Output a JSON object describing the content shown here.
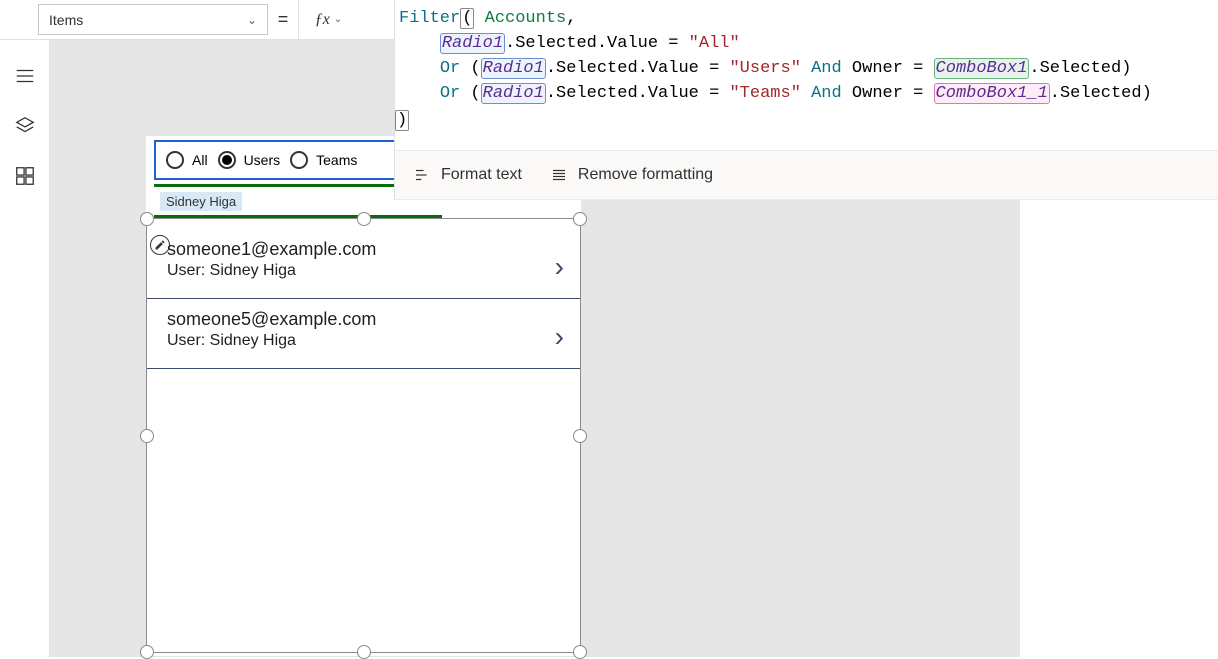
{
  "property_selector": {
    "value": "Items"
  },
  "formula": {
    "tokens": [
      [
        {
          "t": "Filter",
          "c": "t-fn"
        },
        {
          "t": "(",
          "c": "paren-box t-plain"
        },
        {
          "t": " ",
          "c": "t-plain"
        },
        {
          "t": "Accounts",
          "c": "t-ds"
        },
        {
          "t": ",",
          "c": "t-plain"
        }
      ],
      [
        {
          "t": "    ",
          "c": "t-plain"
        },
        {
          "t": "Radio1",
          "c": "t-ref hl-blue"
        },
        {
          "t": ".Selected.Value = ",
          "c": "t-plain"
        },
        {
          "t": "\"All\"",
          "c": "t-str"
        }
      ],
      [
        {
          "t": "    ",
          "c": "t-plain"
        },
        {
          "t": "Or",
          "c": "t-fn"
        },
        {
          "t": " (",
          "c": "t-plain"
        },
        {
          "t": "Radio1",
          "c": "t-ref hl-blue"
        },
        {
          "t": ".Selected.Value = ",
          "c": "t-plain"
        },
        {
          "t": "\"Users\"",
          "c": "t-str"
        },
        {
          "t": " ",
          "c": "t-plain"
        },
        {
          "t": "And",
          "c": "t-fn"
        },
        {
          "t": " Owner = ",
          "c": "t-plain"
        },
        {
          "t": "ComboBox1",
          "c": "t-ref hl-green"
        },
        {
          "t": ".Selected)",
          "c": "t-plain"
        }
      ],
      [
        {
          "t": "    ",
          "c": "t-plain"
        },
        {
          "t": "Or",
          "c": "t-fn"
        },
        {
          "t": " (",
          "c": "t-plain"
        },
        {
          "t": "Radio1",
          "c": "t-ref hl-blue"
        },
        {
          "t": ".Selected.Value = ",
          "c": "t-plain"
        },
        {
          "t": "\"Teams\"",
          "c": "t-str"
        },
        {
          "t": " ",
          "c": "t-plain"
        },
        {
          "t": "And",
          "c": "t-fn"
        },
        {
          "t": " Owner = ",
          "c": "t-plain"
        },
        {
          "t": "ComboBox1_1",
          "c": "t-ref hl-pink"
        },
        {
          "t": ".Selected)",
          "c": "t-plain"
        }
      ]
    ],
    "trailing_close": ")"
  },
  "format_bar": {
    "format_text": "Format text",
    "remove_formatting": "Remove formatting"
  },
  "radio": {
    "options": [
      "All",
      "Users",
      "Teams"
    ],
    "selected_index": 1
  },
  "combo": {
    "selected_tag": "Sidney Higa"
  },
  "gallery": {
    "items": [
      {
        "title": "someone1@example.com",
        "subtitle": "User: Sidney Higa"
      },
      {
        "title": "someone5@example.com",
        "subtitle": "User: Sidney Higa"
      }
    ]
  }
}
